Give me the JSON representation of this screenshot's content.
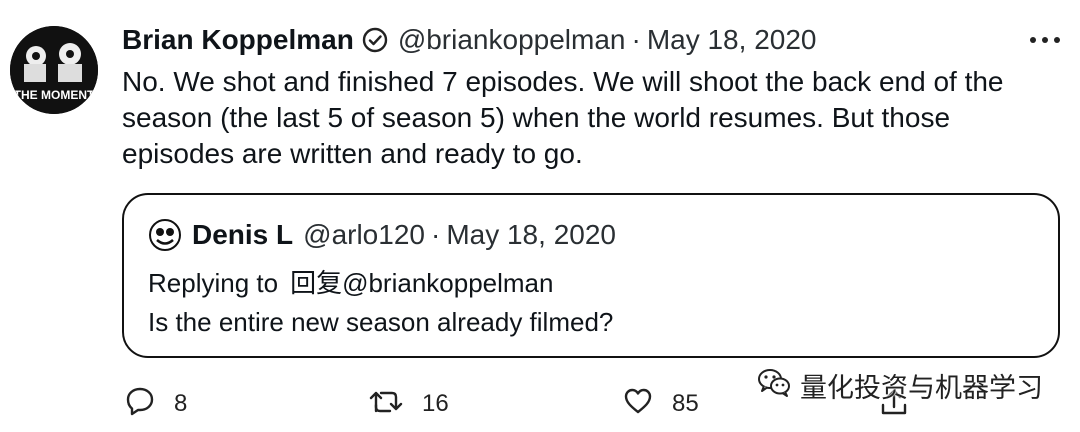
{
  "tweet": {
    "author": {
      "name": "Brian Koppelman",
      "handle": "@briankoppelman",
      "avatar_text": "THE MOMENT"
    },
    "separator": "·",
    "date": "May 18, 2020",
    "text": "No. We shot and finished 7 episodes. We will shoot the back end of the season (the last 5 of season 5) when the world resumes. But those episodes are written and ready to go.",
    "quote": {
      "author": {
        "name": "Denis L",
        "handle": "@arlo120"
      },
      "date": "May 18, 2020",
      "replying_label": "Replying to",
      "replying_target": "回复@briankoppelman",
      "text": "Is the entire new season already filmed?"
    },
    "actions": {
      "replies": "8",
      "retweets": "16",
      "likes": "85"
    }
  },
  "watermark": {
    "text": "量化投资与机器学习",
    "icon": "wechat-icon"
  },
  "colors": {
    "text": "#0f1419",
    "secondary_text": "#2a2f33",
    "border": "#111111",
    "background": "#ffffff"
  }
}
